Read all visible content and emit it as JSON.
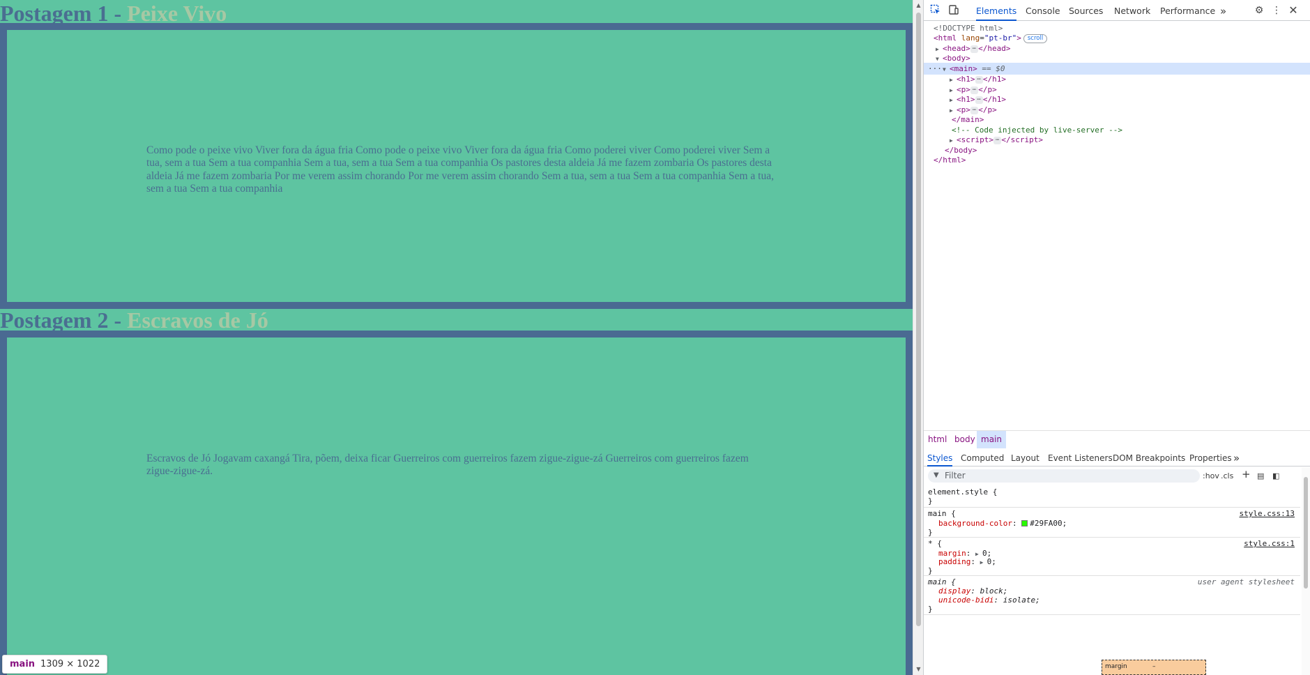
{
  "page": {
    "posts": [
      {
        "title_prefix": "Postagem 1",
        "dash": " - ",
        "title_subject": "Peixe Vivo",
        "text": "Como pode o peixe vivo Viver fora da água fria Como pode o peixe vivo Viver fora da água fria Como poderei viver Como poderei viver Sem a tua, sem a tua Sem a tua companhia Sem a tua, sem a tua Sem a tua companhia Os pastores desta aldeia Já me fazem zombaria Os pastores desta aldeia Já me fazem zombaria Por me verem assim chorando Por me verem assim chorando Sem a tua, sem a tua Sem a tua companhia Sem a tua, sem a tua Sem a tua companhia"
      },
      {
        "title_prefix": "Postagem 2",
        "dash": " - ",
        "title_subject": "Escravos de Jó",
        "text": "Escravos de Jó Jogavam caxangá Tira, põem, deixa ficar Guerreiros com guerreiros fazem zigue-zigue-zá Guerreiros com guerreiros fazem zigue-zigue-zá."
      }
    ],
    "size_tooltip": {
      "tag": "main",
      "size": "1309 × 1022"
    }
  },
  "devtools": {
    "tabs": [
      "Elements",
      "Console",
      "Sources",
      "Network",
      "Performance"
    ],
    "active_tab": "Elements",
    "more_tabs": "»",
    "dom": {
      "doctype": "<!DOCTYPE html>",
      "html_tag": "html",
      "lang_attr": "lang",
      "lang_value": "\"pt-br\"",
      "scroll_badge": "scroll",
      "head": "head",
      "body": "body",
      "main": "main",
      "selected_marker": "== $0",
      "children": [
        "h1",
        "p",
        "h1",
        "p"
      ],
      "comment": "<!-- Code injected by live-server -->",
      "script": "script",
      "ellipsis": "⋯",
      "row_dots": "···"
    },
    "breadcrumbs": [
      "html",
      "body",
      "main"
    ],
    "styles_tabs": [
      "Styles",
      "Computed",
      "Layout",
      "Event Listeners",
      "DOM Breakpoints",
      "Properties"
    ],
    "filter": {
      "placeholder": "Filter",
      "hov": ":hov",
      "cls": ".cls"
    },
    "rules": {
      "element_style": "element.style {",
      "close": "}",
      "main_selector": "main {",
      "main_source": "style.css:13",
      "main_prop": "background-color",
      "main_value": "#29FA00;",
      "swatch_color": "#29FA00",
      "star_selector": "* {",
      "star_source": "style.css:1",
      "margin_prop": "margin",
      "margin_value": "0;",
      "padding_prop": "padding",
      "padding_value": "0;",
      "ua_selector": "main {",
      "ua_source": "user agent stylesheet",
      "display_prop": "display",
      "display_value": "block;",
      "unicode_prop": "unicode-bidi",
      "unicode_value": "isolate;"
    },
    "box_model_label": "margin",
    "box_model_value": "–"
  }
}
